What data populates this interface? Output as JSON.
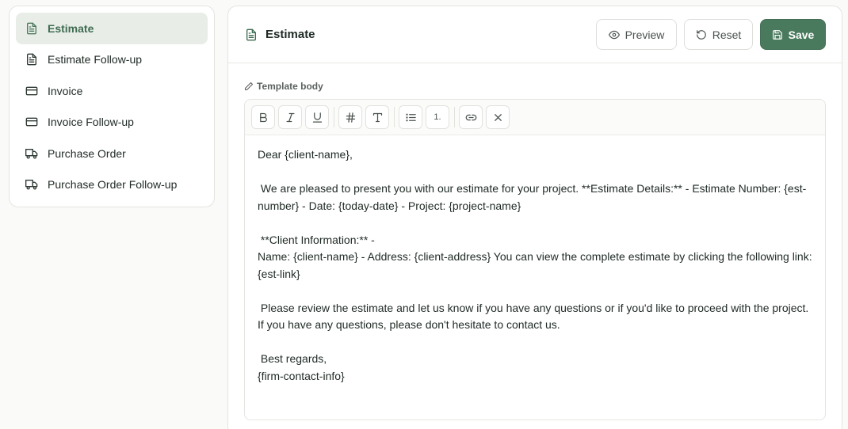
{
  "sidebar": {
    "items": [
      {
        "label": "Estimate",
        "icon": "file-text-icon",
        "active": true
      },
      {
        "label": "Estimate Follow-up",
        "icon": "file-text-icon"
      },
      {
        "label": "Invoice",
        "icon": "credit-card-icon"
      },
      {
        "label": "Invoice Follow-up",
        "icon": "credit-card-icon"
      },
      {
        "label": "Purchase Order",
        "icon": "truck-icon"
      },
      {
        "label": "Purchase Order Follow-up",
        "icon": "truck-icon"
      }
    ]
  },
  "header": {
    "title": "Estimate",
    "title_icon": "file-text-icon",
    "preview_label": "Preview",
    "reset_label": "Reset",
    "save_label": "Save"
  },
  "editor": {
    "label": "Template body",
    "label_icon": "pencil-icon",
    "toolbar": [
      {
        "name": "bold",
        "icon": "bold-icon"
      },
      {
        "name": "italic",
        "icon": "italic-icon"
      },
      {
        "name": "underline",
        "icon": "underline-icon"
      },
      {
        "name": "heading",
        "icon": "hash-icon"
      },
      {
        "name": "text",
        "icon": "type-icon"
      },
      {
        "name": "bullet-list",
        "icon": "list-icon"
      },
      {
        "name": "numbered-list",
        "icon": "list-ordered-icon",
        "glyph": "1."
      },
      {
        "name": "link",
        "icon": "link-icon"
      },
      {
        "name": "clear",
        "icon": "x-icon"
      }
    ],
    "body": "Dear {client-name},\n\n We are pleased to present you with our estimate for your project. **Estimate Details:** - Estimate Number: {est-number} - Date: {today-date} - Project: {project-name}\n\n **Client Information:** -\nName: {client-name} - Address: {client-address} You can view the complete estimate by clicking the following link: {est-link}\n\n Please review the estimate and let us know if you have any questions or if you'd like to proceed with the project. If you have any questions, please don't hesitate to contact us.\n\n Best regards,\n{firm-contact-info}"
  },
  "colors": {
    "accent": "#4a7a5d",
    "active_bg": "#e8ede8",
    "border": "#e4e4e0"
  }
}
